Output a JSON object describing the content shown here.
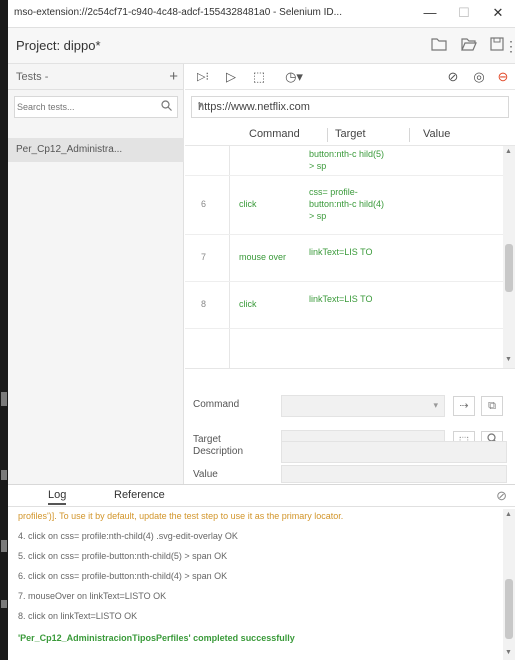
{
  "window": {
    "title": "mso-extension://2c54cf71-c940-4c48-adcf-1554328481a0 - Selenium ID...",
    "minimize": "—",
    "maximize": "☐",
    "close": "✕"
  },
  "project": {
    "label": "Project: dippo*"
  },
  "sidebar": {
    "tests_label": "Tests -",
    "add": "+",
    "search_placeholder": "Search tests...",
    "test_item": "Per_Cp12_Administra..."
  },
  "toolbar": {
    "run_all": "▷⁝",
    "run": "▷",
    "step": "⬚",
    "speed": "◷▾",
    "disable_breakpoints": "⊘",
    "pause_exceptions": "◎",
    "record": "⊖"
  },
  "url": {
    "value": "https://www.netflix.com"
  },
  "table": {
    "headers": [
      "Command",
      "Target",
      "Value"
    ],
    "rows": [
      {
        "index": "",
        "command": "",
        "target": "button:nth-c hild(5) > sp"
      },
      {
        "index": "6",
        "command": "click",
        "target": "css= profile-button:nth-c hild(4) > sp"
      },
      {
        "index": "7",
        "command": "mouse over",
        "target": "linkText=LIS TO"
      },
      {
        "index": "8",
        "command": "click",
        "target": "linkText=LIS TO"
      }
    ]
  },
  "editor": {
    "command_label": "Command",
    "target_label": "Target",
    "value_label": "Value",
    "description_label": "Description"
  },
  "log": {
    "tab_log": "Log",
    "tab_reference": "Reference",
    "lines": [
      "profiles')]. To use it by default, update the test step to use it as the primary locator.",
      "4.  click on css= profile:nth-child(4) .svg-edit-overlay OK",
      "5.  click on css= profile-button:nth-child(5) > span OK",
      "6.  click on css= profile-button:nth-child(4) > span OK",
      "7.  mouseOver on linkText=LISTO OK",
      "8.  click on linkText=LISTO OK",
      "'Per_Cp12_AdministracionTiposPerfiles' completed successfully"
    ]
  },
  "colors": {
    "accent_green": "#3a9a3a",
    "warning_orange": "#d2952a",
    "record_red": "#e24a2a"
  }
}
